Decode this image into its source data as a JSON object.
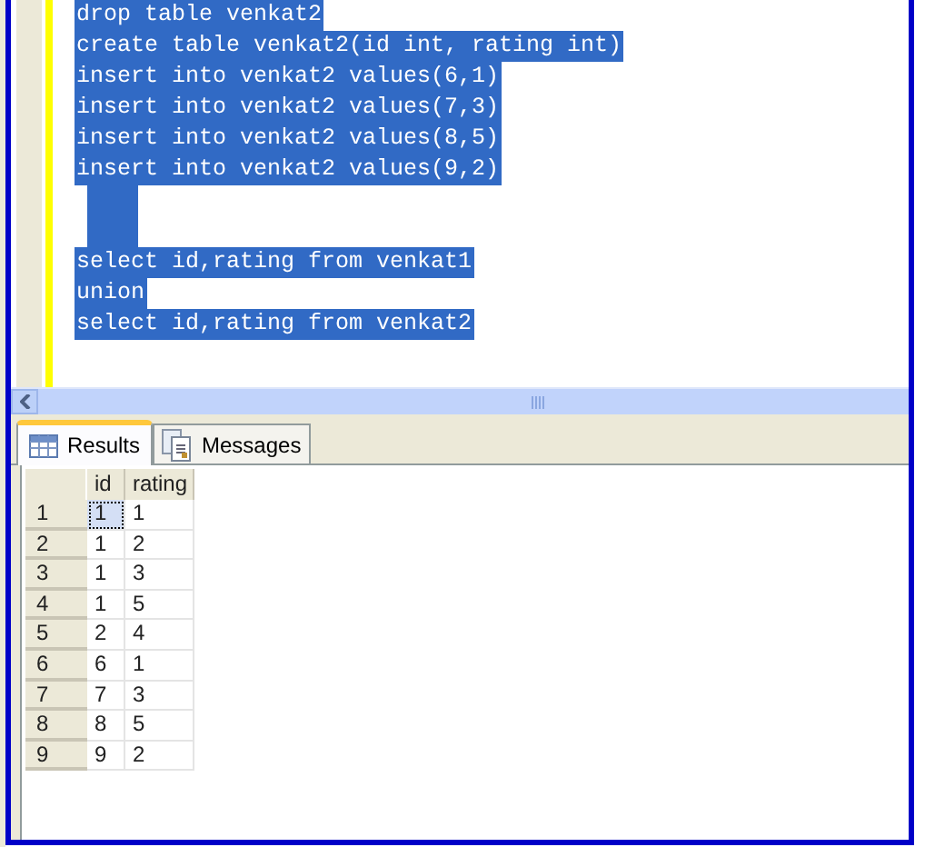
{
  "editor": {
    "lines": [
      {
        "kind": "code",
        "text": "drop table venkat2",
        "selected": true
      },
      {
        "kind": "code",
        "text": "create table venkat2(id int, rating int)",
        "selected": true
      },
      {
        "kind": "code",
        "text": "insert into venkat2 values(6,1)",
        "selected": true
      },
      {
        "kind": "code",
        "text": "insert into venkat2 values(7,3)",
        "selected": true
      },
      {
        "kind": "code",
        "text": "insert into venkat2 values(8,5)",
        "selected": true
      },
      {
        "kind": "code",
        "text": "insert into venkat2 values(9,2)",
        "selected": true
      },
      {
        "kind": "blank",
        "selected": true
      },
      {
        "kind": "blank",
        "selected": true
      },
      {
        "kind": "code",
        "text": "select id,rating from venkat1",
        "selected": true
      },
      {
        "kind": "code",
        "text": "union",
        "selected": true
      },
      {
        "kind": "code",
        "text": "select id,rating from venkat2",
        "selected": true
      }
    ]
  },
  "tabs": [
    {
      "label": "Results",
      "kind": "results",
      "selected": true
    },
    {
      "label": "Messages",
      "kind": "messages",
      "selected": false
    }
  ],
  "grid": {
    "columns": [
      "id",
      "rating"
    ],
    "rows": [
      {
        "number": "1",
        "cells": [
          {
            "text": "1",
            "focused": true
          },
          {
            "text": "1",
            "focused": false
          }
        ]
      },
      {
        "number": "2",
        "cells": [
          {
            "text": "1",
            "focused": false
          },
          {
            "text": "2",
            "focused": false
          }
        ]
      },
      {
        "number": "3",
        "cells": [
          {
            "text": "1",
            "focused": false
          },
          {
            "text": "3",
            "focused": false
          }
        ]
      },
      {
        "number": "4",
        "cells": [
          {
            "text": "1",
            "focused": false
          },
          {
            "text": "5",
            "focused": false
          }
        ]
      },
      {
        "number": "5",
        "cells": [
          {
            "text": "2",
            "focused": false
          },
          {
            "text": "4",
            "focused": false
          }
        ]
      },
      {
        "number": "6",
        "cells": [
          {
            "text": "6",
            "focused": false
          },
          {
            "text": "1",
            "focused": false
          }
        ]
      },
      {
        "number": "7",
        "cells": [
          {
            "text": "7",
            "focused": false
          },
          {
            "text": "3",
            "focused": false
          }
        ]
      },
      {
        "number": "8",
        "cells": [
          {
            "text": "8",
            "focused": false
          },
          {
            "text": "5",
            "focused": false
          }
        ]
      },
      {
        "number": "9",
        "cells": [
          {
            "text": "9",
            "focused": false
          },
          {
            "text": "2",
            "focused": false
          }
        ]
      }
    ]
  }
}
